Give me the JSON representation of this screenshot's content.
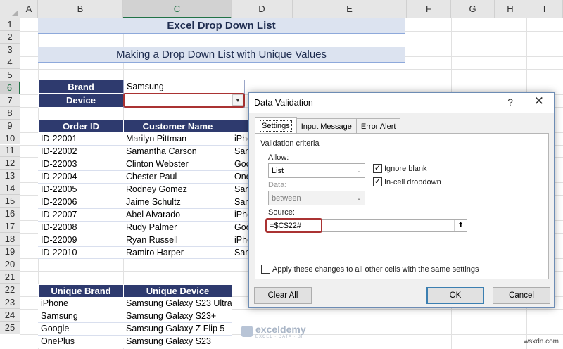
{
  "columns": [
    "A",
    "B",
    "C",
    "D",
    "E",
    "F",
    "G",
    "H",
    "I"
  ],
  "selected_column": "C",
  "rows": [
    "1",
    "2",
    "3",
    "4",
    "5",
    "6",
    "7",
    "8",
    "9",
    "10",
    "11",
    "12",
    "13",
    "14",
    "15",
    "16",
    "17",
    "18",
    "19",
    "20",
    "21",
    "22",
    "23",
    "24",
    "25"
  ],
  "selected_row": "6",
  "sheet": {
    "title": "Excel Drop Down List",
    "subtitle": "Making a Drop Down List with Unique Values",
    "brand_label": "Brand",
    "brand_value": "Samsung",
    "device_label": "Device",
    "device_value": "",
    "dropdown_arrow": "▼",
    "orders": {
      "headers": [
        "Order ID",
        "Customer Name"
      ],
      "rows": [
        {
          "id": "ID-22001",
          "name": "Marilyn Pittman",
          "device": "iPho"
        },
        {
          "id": "ID-22002",
          "name": "Samantha Carson",
          "device": "Sam"
        },
        {
          "id": "ID-22003",
          "name": "Clinton Webster",
          "device": "Goo"
        },
        {
          "id": "ID-22004",
          "name": "Chester Paul",
          "device": "One"
        },
        {
          "id": "ID-22005",
          "name": "Rodney Gomez",
          "device": "Sam"
        },
        {
          "id": "ID-22006",
          "name": "Jaime Schultz",
          "device": "Sam"
        },
        {
          "id": "ID-22007",
          "name": "Abel Alvarado",
          "device": "iPho"
        },
        {
          "id": "ID-22008",
          "name": "Rudy Palmer",
          "device": "Goo"
        },
        {
          "id": "ID-22009",
          "name": "Ryan Russell",
          "device": "iPho"
        },
        {
          "id": "ID-22010",
          "name": "Ramiro Harper",
          "device": "Sam"
        }
      ]
    },
    "unique": {
      "headers": [
        "Unique Brand",
        "Unique Device"
      ],
      "rows": [
        {
          "brand": "iPhone",
          "device": "Samsung Galaxy S23 Ultra"
        },
        {
          "brand": "Samsung",
          "device": "Samsung Galaxy S23+"
        },
        {
          "brand": "Google",
          "device": "Samsung Galaxy Z Flip 5"
        },
        {
          "brand": "OnePlus",
          "device": "Samsung Galaxy S23"
        }
      ]
    }
  },
  "dialog": {
    "title": "Data Validation",
    "help": "?",
    "close": "✕",
    "tabs": [
      "Settings",
      "Input Message",
      "Error Alert"
    ],
    "active_tab": "Settings",
    "section": "Validation criteria",
    "allow_label": "Allow:",
    "allow_value": "List",
    "data_label": "Data:",
    "data_value": "between",
    "ignore_blank_label": "Ignore blank",
    "ignore_blank_checked": true,
    "incell_label": "In-cell dropdown",
    "incell_checked": true,
    "source_label": "Source:",
    "source_value": "=$C$22#",
    "apply_label": "Apply these changes to all other cells with the same settings",
    "apply_checked": false,
    "clear_all": "Clear All",
    "ok": "OK",
    "cancel": "Cancel",
    "check_mark": "✓",
    "chevron": "⌄",
    "collapse_icon": "⬆"
  },
  "watermark": {
    "name": "exceldemy",
    "tagline": "EXCEL · DATA · BI"
  },
  "site": "wsxdn.com",
  "colors": {
    "header_fill": "#2e3a6e",
    "banner_fill": "#dce3f0",
    "highlight": "#aa3333",
    "excel_green": "#217346"
  }
}
